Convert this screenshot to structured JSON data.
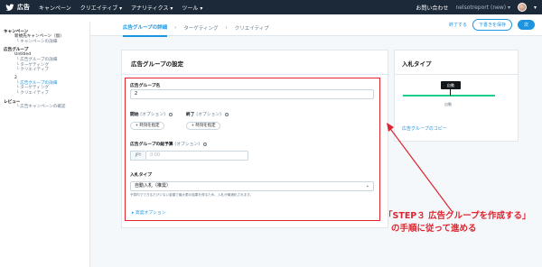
{
  "topbar": {
    "brand": "広告",
    "nav": [
      "キャンペーン",
      "クリエイティブ ▾",
      "アナリティクス ▾",
      "ツール ▾"
    ],
    "help": "お問い合わせ",
    "account": "nelsotreport (new) ▾"
  },
  "breadcrumb": {
    "items": [
      "広告グループの詳細",
      "ターゲティング",
      "クリエイティブ"
    ],
    "separators": [
      "›",
      "›"
    ]
  },
  "actions": {
    "exit": "終了する",
    "save_draft": "下書きを保存",
    "next": "次"
  },
  "sidebar": {
    "campaign_header": "キャンペーン",
    "campaign_name": "新規先キャンペーン（仮）",
    "campaign_details": "└ キャンペーンの詳細",
    "adgroup_header": "広告グループ",
    "group1_name": "Untitled",
    "group1_sub": [
      "└ 広告グループの詳細",
      "└ ターゲティング",
      "└ クリエイティブ"
    ],
    "group2_name": "2",
    "group2_sub": [
      "└ 広告グループの詳細",
      "└ ターゲティング",
      "└ クリエイティブ"
    ],
    "review_header": "レビュー",
    "review_sub": "└ 広告キャンペーンの確認"
  },
  "form": {
    "title": "広告グループの設定",
    "name_label": "広告グループ名",
    "name_value": "2",
    "start_label": "開始",
    "end_label": "終了",
    "optional": "(オプション)",
    "start_button": "+ 時刻を指定",
    "end_button": "+ 時刻を指定",
    "budget_label": "広告グループの総予算",
    "currency": "JPY",
    "budget_placeholder": "0.00",
    "bid_type_label": "入札タイプ",
    "bid_type_value": "自動入札（推奨）",
    "bid_help": "予算内でできるだけ少ない金額で最大限の結果を得るため、入札が最適化されます。",
    "advanced": "▸ 高度オプション"
  },
  "bid_panel": {
    "title": "入札タイプ",
    "marker": "自動",
    "auto_label": "自動",
    "copy_link": "広告グループのコピー"
  },
  "annotation": {
    "line1": "「STEP３ 広告グループを作成する」",
    "line2": "の手順に従って進める"
  },
  "colors": {
    "accent": "#1b95e0",
    "topbar": "#1c2938",
    "annotation_red": "#e0242f",
    "bid_green": "#19cf86"
  }
}
